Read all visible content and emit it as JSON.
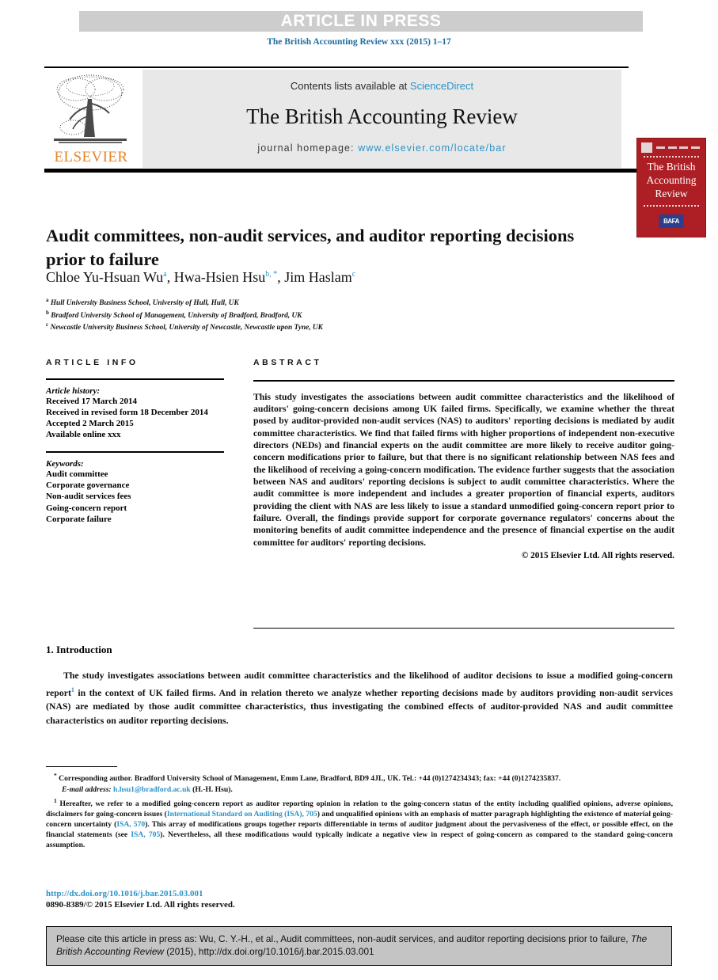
{
  "banner": {
    "text": "ARTICLE IN PRESS"
  },
  "journal_ref": "The British Accounting Review xxx (2015) 1–17",
  "masthead": {
    "publisher_wordmark": "ELSEVIER",
    "contents_prefix": "Contents lists available at ",
    "contents_link": "ScienceDirect",
    "journal_title": "The British Accounting Review",
    "homepage_prefix": "journal homepage: ",
    "homepage_link": "www.elsevier.com/locate/bar"
  },
  "cover": {
    "title": "The British Accounting Review",
    "badge": "BAFA"
  },
  "article": {
    "title": "Audit committees, non-audit services, and auditor reporting decisions prior to failure",
    "authors_plain": "Chloe Yu-Hsuan Wu a, Hwa-Hsien Hsu b,*, Jim Haslam c",
    "authors": [
      {
        "name": "Chloe Yu-Hsuan Wu",
        "marks": "a"
      },
      {
        "name": "Hwa-Hsien Hsu",
        "marks": "b, *"
      },
      {
        "name": "Jim Haslam",
        "marks": "c"
      }
    ],
    "affiliations": [
      {
        "mark": "a",
        "text": "Hull University Business School, University of Hull, Hull, UK"
      },
      {
        "mark": "b",
        "text": "Bradford University School of Management, University of Bradford, Bradford, UK"
      },
      {
        "mark": "c",
        "text": "Newcastle University Business School, University of Newcastle, Newcastle upon Tyne, UK"
      }
    ]
  },
  "article_info": {
    "heading": "ARTICLE INFO",
    "history_label": "Article history:",
    "history": [
      "Received 17 March 2014",
      "Received in revised form 18 December 2014",
      "Accepted 2 March 2015",
      "Available online xxx"
    ],
    "keywords_label": "Keywords:",
    "keywords": [
      "Audit committee",
      "Corporate governance",
      "Non-audit services fees",
      "Going-concern report",
      "Corporate failure"
    ]
  },
  "abstract": {
    "heading": "ABSTRACT",
    "body": "This study investigates the associations between audit committee characteristics and the likelihood of auditors' going-concern decisions among UK failed firms. Specifically, we examine whether the threat posed by auditor-provided non-audit services (NAS) to auditors' reporting decisions is mediated by audit committee characteristics. We find that failed firms with higher proportions of independent non-executive directors (NEDs) and financial experts on the audit committee are more likely to receive auditor going-concern modifications prior to failure, but that there is no significant relationship between NAS fees and the likelihood of receiving a going-concern modification. The evidence further suggests that the association between NAS and auditors' reporting decisions is subject to audit committee characteristics. Where the audit committee is more independent and includes a greater proportion of financial experts, auditors providing the client with NAS are less likely to issue a standard unmodified going-concern report prior to failure. Overall, the findings provide support for corporate governance regulators' concerns about the monitoring benefits of audit committee independence and the presence of financial expertise on the audit committee for auditors' reporting decisions.",
    "copyright": "© 2015 Elsevier Ltd. All rights reserved."
  },
  "introduction": {
    "heading": "1. Introduction",
    "paragraph_part1": "The study investigates associations between audit committee characteristics and the likelihood of auditor decisions to issue a modified going-concern report",
    "footnote_marker": "1",
    "paragraph_part2": " in the context of UK failed firms. And in relation thereto we analyze whether reporting decisions made by auditors providing non-audit services (NAS) are mediated by those audit committee characteristics, thus investigating the combined effects of auditor-provided NAS and audit committee characteristics on auditor reporting decisions."
  },
  "footnotes": {
    "corresponding_mark": "*",
    "corresponding": " Corresponding author. Bradford University School of Management, Emm Lane, Bradford, BD9 4JL, UK. Tel.: +44 (0)1274234343; fax: +44 (0)1274235837.",
    "email_label": "E-mail address:",
    "email": "h.hsu1@bradford.ac.uk",
    "email_suffix": " (H.-H. Hsu).",
    "note1_mark": "1",
    "note1_a": " Hereafter, we refer to a modified going-concern report as auditor reporting opinion in relation to the going-concern status of the entity including qualified opinions, adverse opinions, disclaimers for going-concern issues (",
    "note1_link1": "International Standard on Auditing (ISA), 705",
    "note1_b": ") and unqualified opinions with an emphasis of matter paragraph highlighting the existence of material going-concern uncertainty (",
    "note1_link2": "ISA, 570",
    "note1_c": "). This array of modifications groups together reports differentiable in terms of auditor judgment about the pervasiveness of the effect, or possible effect, on the financial statements (see ",
    "note1_link3": "ISA, 705",
    "note1_d": "). Nevertheless, all these modifications would typically indicate a negative view in respect of going-concern as compared to the standard going-concern assumption."
  },
  "doi": "http://dx.doi.org/10.1016/j.bar.2015.03.001",
  "issn": "0890-8389/© 2015 Elsevier Ltd. All rights reserved.",
  "cite_box": {
    "prefix": "Please cite this article in press as: Wu, C. Y.-H., et al., Audit committees, non-audit services, and auditor reporting decisions prior to failure, ",
    "journal_italic": "The British Accounting Review",
    "suffix": " (2015), http://dx.doi.org/10.1016/j.bar.2015.03.001"
  },
  "colors": {
    "link": "#2a93c9",
    "journal_ref": "#1d6ca0",
    "banner_bg": "#cdcdcd",
    "masthead_bg": "#e8e8e8",
    "cover_red": "#ad1f24",
    "elsevier_orange": "#e8862a",
    "cite_box_bg": "#c4c4c4"
  }
}
